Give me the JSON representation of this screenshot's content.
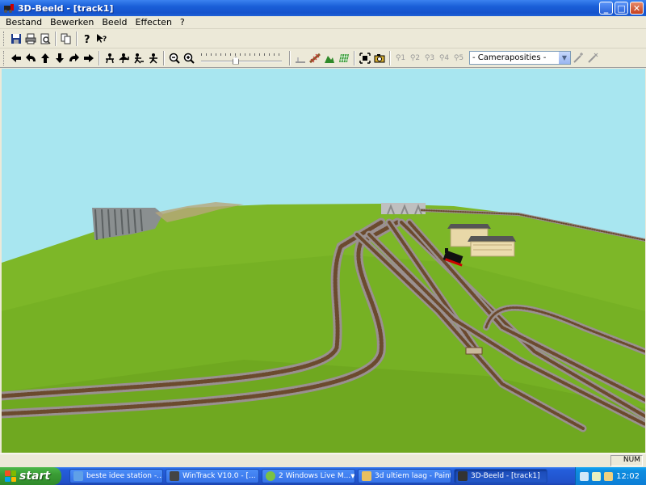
{
  "window": {
    "title": "3D-Beeld - [track1]"
  },
  "window_controls": {
    "minimize": "_",
    "maximize": "□",
    "close": "✕"
  },
  "menu": [
    "Bestand",
    "Bewerken",
    "Beeld",
    "Effecten",
    "?"
  ],
  "toolbar1": {
    "icons": [
      "save-icon",
      "print-icon",
      "print-preview-icon",
      "copy-icon",
      "help-icon",
      "context-help-icon"
    ]
  },
  "toolbar2": {
    "nav_icons": [
      "arrow-left-icon",
      "rotate-left-icon",
      "arrow-up-icon",
      "arrow-down-icon",
      "rotate-right-icon",
      "arrow-right-icon"
    ],
    "walk_icons": [
      "walk-1-icon",
      "walk-2-icon",
      "walk-3-icon",
      "walk-4-icon"
    ],
    "zoom_icons": [
      "zoom-out-icon",
      "zoom-in-icon"
    ],
    "slider_level": 0.42,
    "scene_icons": [
      "ground-icon",
      "track-icon",
      "terrain-icon",
      "grid-icon"
    ],
    "camera_icons": [
      "fit-view-icon",
      "camera-icon"
    ],
    "camera_numbers": [
      "1",
      "2",
      "3",
      "4",
      "5"
    ],
    "camera_select": "- Cameraposities -",
    "camera_action_icons": [
      "camera-add-icon",
      "camera-delete-icon"
    ]
  },
  "status": {
    "num": "NUM"
  },
  "taskbar": {
    "start": "start",
    "tasks": [
      {
        "label": "beste idee station -...",
        "active": false
      },
      {
        "label": "WinTrack  V10.0 - [...",
        "active": false
      },
      {
        "label": "2 Windows Live M...",
        "active": false
      },
      {
        "label": "3d ultiem laag - Paint",
        "active": false
      },
      {
        "label": "3D-Beeld - [track1]",
        "active": true
      }
    ],
    "clock": "12:02"
  },
  "colors": {
    "sky": "#a8e6f0",
    "grass": "#7db728",
    "rail_bed": "#8f7f6f",
    "xp_blue": "#245edb",
    "start_green": "#3a9c35"
  }
}
